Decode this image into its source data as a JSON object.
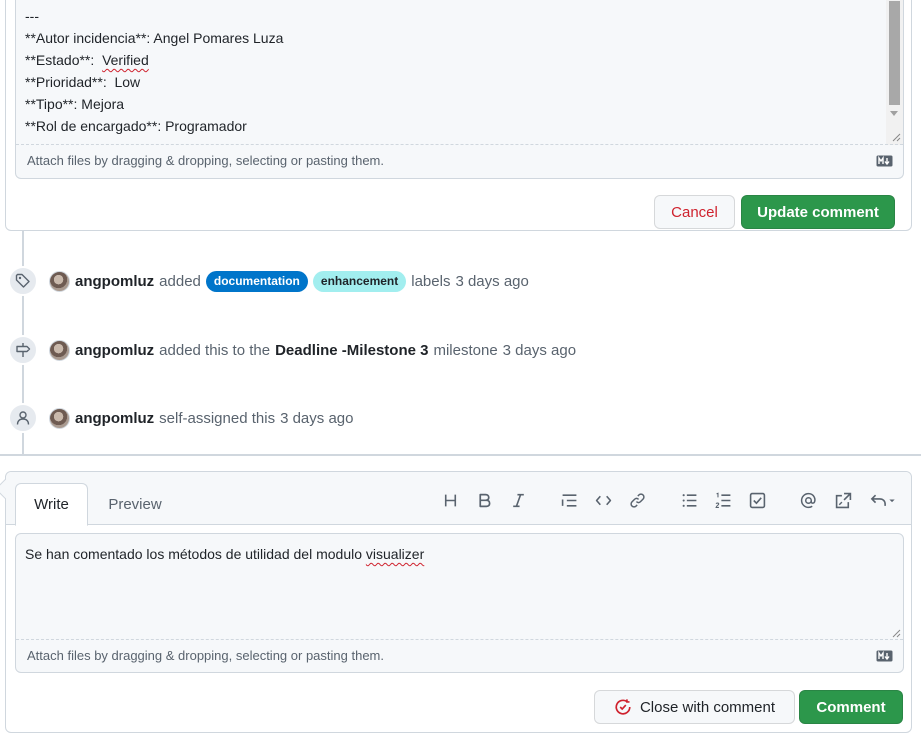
{
  "edit": {
    "lines": [
      "---",
      "**Autor incidencia**: Angel Pomares Luza",
      "**Estado**:  ",
      "**Prioridad**:  Low",
      "**Tipo**: Mejora",
      "**Rol de encargado**: Programador"
    ],
    "estado_value": "Verified",
    "attach_hint": "Attach files by dragging & dropping, selecting or pasting them.",
    "cancel_label": "Cancel",
    "update_label": "Update comment"
  },
  "timeline": {
    "labels_event": {
      "user": "angpomluz",
      "action": "added",
      "labels": [
        {
          "name": "documentation",
          "bg": "#0075ca",
          "fg": "#ffffff"
        },
        {
          "name": "enhancement",
          "bg": "#a2eeef",
          "fg": "#1f2328"
        }
      ],
      "suffix": "labels",
      "time": "3 days ago"
    },
    "milestone_event": {
      "user": "angpomluz",
      "action": "added this to the",
      "milestone": "Deadline -Milestone 3",
      "suffix": "milestone",
      "time": "3 days ago"
    },
    "assign_event": {
      "user": "angpomluz",
      "action": "self-assigned this",
      "time": "3 days ago"
    }
  },
  "new_comment": {
    "tab_write": "Write",
    "tab_preview": "Preview",
    "text_before": "Se han comentado los métodos de utilidad del modulo ",
    "text_misspelled": "visualizer",
    "attach_hint": "Attach files by dragging & dropping, selecting or pasting them.",
    "close_label": "Close with comment",
    "comment_label": "Comment",
    "toolbar": [
      "heading-icon",
      "bold-icon",
      "italic-icon",
      "quote-icon",
      "code-icon",
      "link-icon",
      "unordered-list-icon",
      "ordered-list-icon",
      "task-list-icon",
      "mention-icon",
      "reference-icon",
      "saved-replies-icon"
    ]
  },
  "colors": {
    "green": "#2c974b",
    "danger": "#cf222e",
    "muted": "#59636e"
  }
}
